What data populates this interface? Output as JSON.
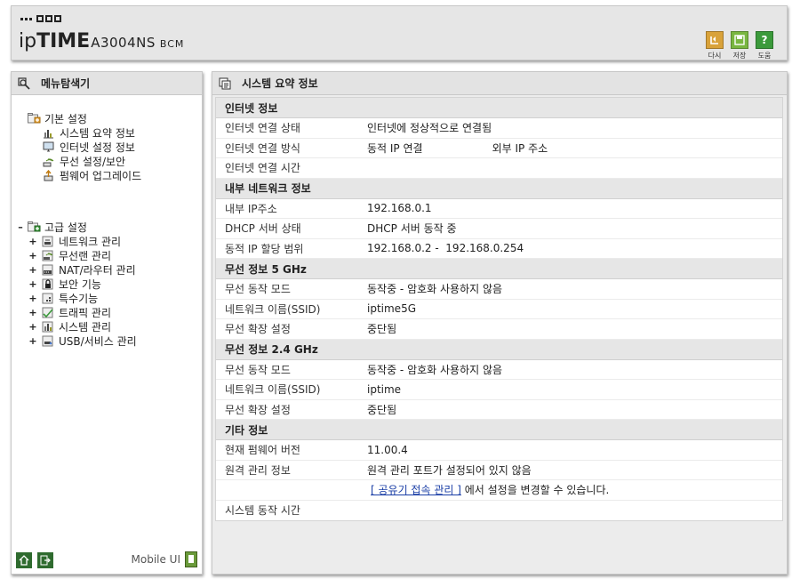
{
  "header": {
    "brand_ip": "ip",
    "brand_time": "TIME",
    "model": "A3004NS",
    "chipset": "BCM",
    "tools": [
      {
        "icon": "back-icon",
        "label": "다시",
        "color": "#d9a23a"
      },
      {
        "icon": "save-icon",
        "label": "저장",
        "color": "#79b640"
      },
      {
        "icon": "help-icon",
        "label": "도움",
        "glyph": "?",
        "color": "#3b9a3b"
      }
    ]
  },
  "sidebar": {
    "title": "메뉴탐색기",
    "basic": {
      "label": "기본 설정",
      "items": [
        {
          "icon": "chart-icon",
          "label": "시스템 요약 정보"
        },
        {
          "icon": "monitor-icon",
          "label": "인터넷 설정 정보"
        },
        {
          "icon": "wireless-icon",
          "label": "무선 설정/보안"
        },
        {
          "icon": "upgrade-icon",
          "label": "펌웨어 업그레이드"
        }
      ]
    },
    "advanced": {
      "toggle": "–",
      "label": "고급 설정",
      "items": [
        {
          "icon": "network-icon",
          "label": "네트워크 관리"
        },
        {
          "icon": "wireless-icon",
          "label": "무선랜 관리"
        },
        {
          "icon": "router-icon",
          "label": "NAT/라우터 관리"
        },
        {
          "icon": "lock-icon",
          "label": "보안 기능"
        },
        {
          "icon": "special-icon",
          "label": "특수기능"
        },
        {
          "icon": "traffic-icon",
          "label": "트래픽 관리"
        },
        {
          "icon": "chart-icon",
          "label": "시스템 관리"
        },
        {
          "icon": "usb-icon",
          "label": "USB/서비스 관리"
        }
      ],
      "expand_symbol": "+"
    },
    "footer": {
      "mobile_label": "Mobile UI"
    }
  },
  "main": {
    "title": "시스템 요약 정보",
    "sections": [
      {
        "title": "인터넷 정보",
        "rows": [
          {
            "key": "인터넷 연결 상태",
            "value": "인터넷에 정상적으로 연결됨"
          },
          {
            "key": "인터넷 연결 방식",
            "value": "동적 IP 연결",
            "extra": "외부 IP 주소"
          },
          {
            "key": "인터넷 연결 시간",
            "value": ""
          }
        ]
      },
      {
        "title": "내부 네트워크 정보",
        "rows": [
          {
            "key": "내부 IP주소",
            "value": "192.168.0.1"
          },
          {
            "key": "DHCP 서버 상태",
            "value": "DHCP 서버 동작 중"
          },
          {
            "key": "동적 IP 할당 범위",
            "value": "192.168.0.2 -  192.168.0.254"
          }
        ]
      },
      {
        "title": "무선 정보 5 GHz",
        "rows": [
          {
            "key": "무선 동작 모드",
            "value": "동작중 - 암호화 사용하지 않음"
          },
          {
            "key": "네트워크 이름(SSID)",
            "value": "iptime5G"
          },
          {
            "key": "무선 확장 설정",
            "value": "중단됨"
          }
        ]
      },
      {
        "title": "무선 정보 2.4 GHz",
        "rows": [
          {
            "key": "무선 동작 모드",
            "value": "동작중 - 암호화 사용하지 않음"
          },
          {
            "key": "네트워크 이름(SSID)",
            "value": "iptime"
          },
          {
            "key": "무선 확장 설정",
            "value": "중단됨"
          }
        ]
      },
      {
        "title": "기타 정보",
        "rows": [
          {
            "key": "현재 펌웨어 버전",
            "value": "11.00.4"
          },
          {
            "key": "원격 관리 정보",
            "value": "원격 관리 포트가 설정되어 있지 않음"
          },
          {
            "key": "",
            "link": "[ 공유기 접속 관리 ]",
            "value": " 에서 설정을 변경할 수 있습니다."
          },
          {
            "key": "시스템 동작 시간",
            "value": ""
          }
        ]
      }
    ]
  }
}
